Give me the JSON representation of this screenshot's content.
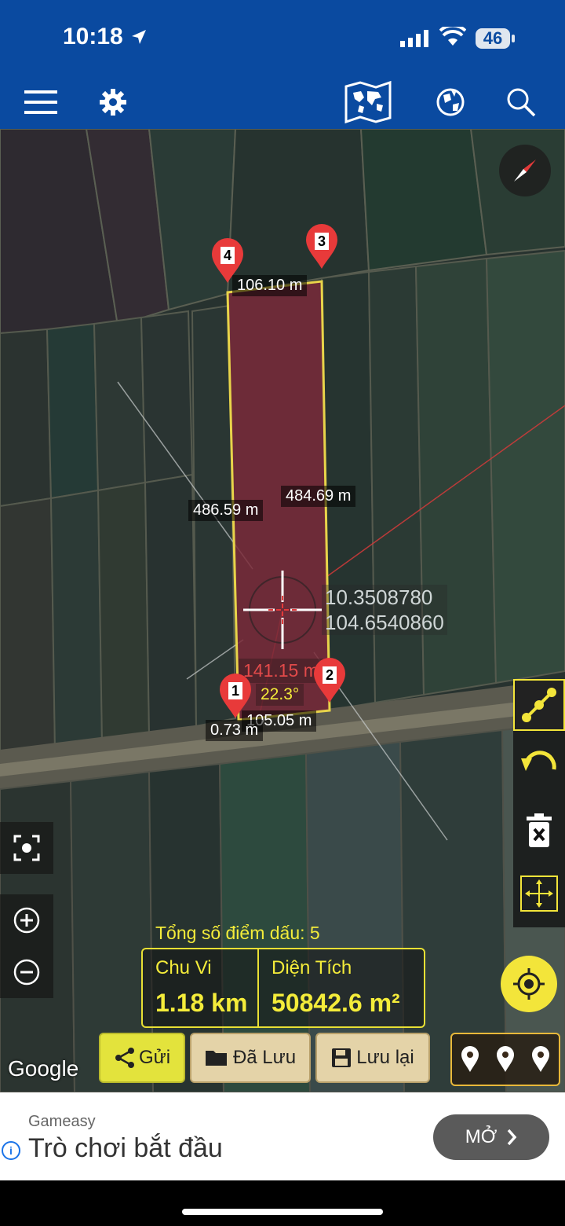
{
  "status_bar": {
    "time": "10:18",
    "battery": "46"
  },
  "toolbar": {
    "icons": [
      "menu-icon",
      "gear-icon",
      "world-map-icon",
      "globe-icon",
      "search-icon"
    ]
  },
  "map": {
    "distance_labels": {
      "top": "106.10 m",
      "left": "486.59 m",
      "right": "484.69 m",
      "bottom": "105.05 m",
      "cursor": "141.15 m",
      "angle": "22.3°",
      "point1": "0.73 m"
    },
    "coordinates": {
      "lat": "10.3508780",
      "lon": "104.6540860"
    },
    "markers": [
      "1",
      "2",
      "3",
      "4"
    ],
    "attribution": "Google"
  },
  "stats": {
    "marker_count_text": "Tổng số điểm dấu: 5",
    "perimeter_label": "Chu Vi",
    "perimeter_value": "1.18 km",
    "area_label": "Diện Tích",
    "area_value": "50842.6 m²"
  },
  "buttons": {
    "send": "Gửi",
    "saved": "Đã Lưu",
    "save": "Lưu lại"
  },
  "ad": {
    "brand": "Gameasy",
    "title": "Trò chơi bắt đầu",
    "cta": "MỞ"
  },
  "colors": {
    "header_blue": "#0a4aa0",
    "accent_yellow": "#f3e53a",
    "polygon_fill": "#7a2a3a",
    "pin_red": "#e83a3a"
  }
}
